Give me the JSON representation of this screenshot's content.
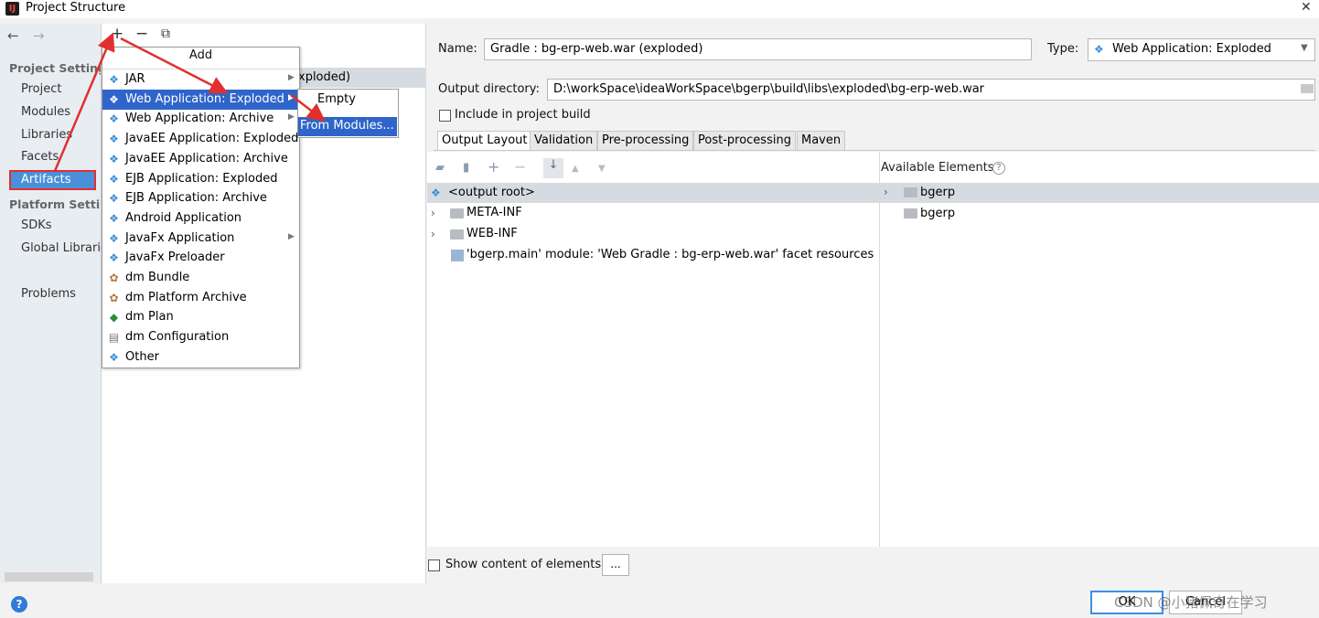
{
  "window": {
    "title": "Project Structure",
    "close_glyph": "✕"
  },
  "nav": {
    "back_glyph": "←",
    "forward_glyph": "→",
    "project_settings_header": "Project Settings",
    "items": [
      "Project",
      "Modules",
      "Libraries",
      "Facets",
      "Artifacts"
    ],
    "platform_settings_header": "Platform Settings",
    "platform_items": [
      "SDKs",
      "Global Libraries"
    ],
    "problems": "Problems",
    "selected": "Artifacts"
  },
  "middle": {
    "toolbar": {
      "add": "+",
      "remove": "−",
      "copy": "⧉"
    },
    "artifact_row": "xploded)"
  },
  "add_menu": {
    "title": "Add",
    "items": [
      {
        "label": "JAR",
        "icon": "diamond-icon",
        "glyph": "❖",
        "submenu": true
      },
      {
        "label": "Web Application: Exploded",
        "icon": "diamond-icon",
        "glyph": "❖",
        "submenu": true,
        "selected": true
      },
      {
        "label": "Web Application: Archive",
        "icon": "diamond-icon",
        "glyph": "❖",
        "submenu": true
      },
      {
        "label": "JavaEE Application: Exploded",
        "icon": "javaee-icon",
        "glyph": "❖",
        "submenu": false
      },
      {
        "label": "JavaEE Application: Archive",
        "icon": "javaee-icon",
        "glyph": "❖",
        "submenu": false
      },
      {
        "label": "EJB Application: Exploded",
        "icon": "ejb-icon",
        "glyph": "❖",
        "submenu": false
      },
      {
        "label": "EJB Application: Archive",
        "icon": "ejb-icon",
        "glyph": "❖",
        "submenu": false
      },
      {
        "label": "Android Application",
        "icon": "android-icon",
        "glyph": "❖",
        "submenu": false
      },
      {
        "label": "JavaFx Application",
        "icon": "javafx-icon",
        "glyph": "❖",
        "submenu": true
      },
      {
        "label": "JavaFx Preloader",
        "icon": "javafx-icon",
        "glyph": "❖",
        "submenu": false
      },
      {
        "label": "dm Bundle",
        "icon": "bundle-icon",
        "glyph": "✿",
        "submenu": false
      },
      {
        "label": "dm Platform Archive",
        "icon": "platform-archive-icon",
        "glyph": "✿",
        "submenu": false
      },
      {
        "label": "dm Plan",
        "icon": "plan-icon",
        "glyph": "◆",
        "submenu": false
      },
      {
        "label": "dm Configuration",
        "icon": "configuration-icon",
        "glyph": "▤",
        "submenu": false
      },
      {
        "label": "Other",
        "icon": "diamond-icon",
        "glyph": "❖",
        "submenu": false
      }
    ],
    "submenu": {
      "empty": "Empty",
      "from_modules": "From Modules..."
    }
  },
  "artifact": {
    "name_label": "Name:",
    "name_value": "Gradle : bg-erp-web.war (exploded)",
    "type_label": "Type:",
    "type_value": "Web Application: Exploded",
    "output_dir_label": "Output directory:",
    "output_dir_value": "D:\\workSpace\\ideaWorkSpace\\bgerp\\build\\libs\\exploded\\bg-erp-web.war",
    "include_in_build": "Include in project build"
  },
  "tabs": [
    "Output Layout",
    "Validation",
    "Pre-processing",
    "Post-processing",
    "Maven"
  ],
  "layout_tree": [
    {
      "label": "<output root>",
      "expandable": false
    },
    {
      "label": "META-INF",
      "expandable": true
    },
    {
      "label": "WEB-INF",
      "expandable": true
    },
    {
      "label": "'bgerp.main' module: 'Web Gradle : bg-erp-web.war' facet resources",
      "expandable": false
    }
  ],
  "available": {
    "label": "Available Elements",
    "items": [
      "bgerp",
      "bgerp"
    ]
  },
  "show_content": "Show content of elements",
  "browse_button": "...",
  "footer": {
    "help": "?",
    "ok": "OK",
    "cancel": "Cancel",
    "watermark": "CSDN @小猪佩奇在学习"
  },
  "colors": {
    "selection": "#2f65ca",
    "annotation_red": "#e03030"
  }
}
